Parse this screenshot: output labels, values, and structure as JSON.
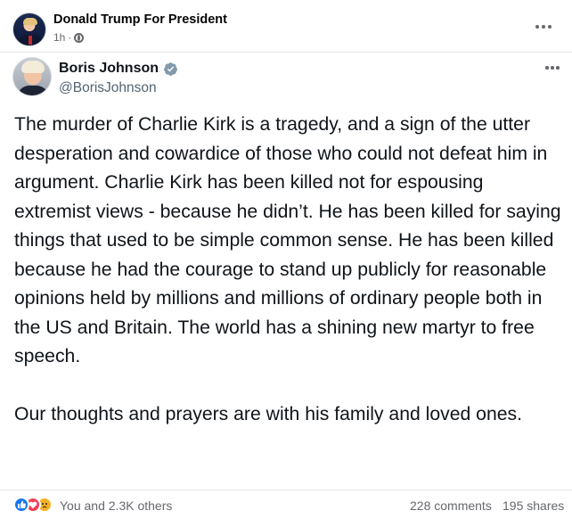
{
  "post": {
    "page_name": "Donald Trump For President",
    "time": "1h",
    "separator": "·",
    "privacy_icon": "globe-icon",
    "more_icon": "more-horizontal-icon"
  },
  "tweet": {
    "author_name": "Boris Johnson",
    "verified_icon": "verified-badge-icon",
    "handle": "@BorisJohnson",
    "more_icon": "more-horizontal-icon",
    "paragraphs": [
      "The murder of Charlie Kirk is a tragedy, and a sign of the utter desperation and cowardice of those who could not defeat him in argument. Charlie Kirk has been killed not for espousing extremist views - because he didn’t. He has been killed for saying things that used to be simple common sense. He has been killed because he had the courage to stand up publicly for reasonable opinions held by millions and millions of ordinary people both in the US and Britain. The world has a shining new martyr to free speech.",
      "Our thoughts and prayers are with his family and loved ones."
    ]
  },
  "footer": {
    "reactions": [
      "like-icon",
      "love-icon",
      "sad-icon"
    ],
    "reaction_summary": "You and 2.3K others",
    "comments": "228 comments",
    "shares": "195 shares"
  },
  "colors": {
    "like": "#1877f2",
    "love": "#f33e58",
    "sad": "#f7b125",
    "verified": "#829aab",
    "secondary_text": "#65676b"
  }
}
